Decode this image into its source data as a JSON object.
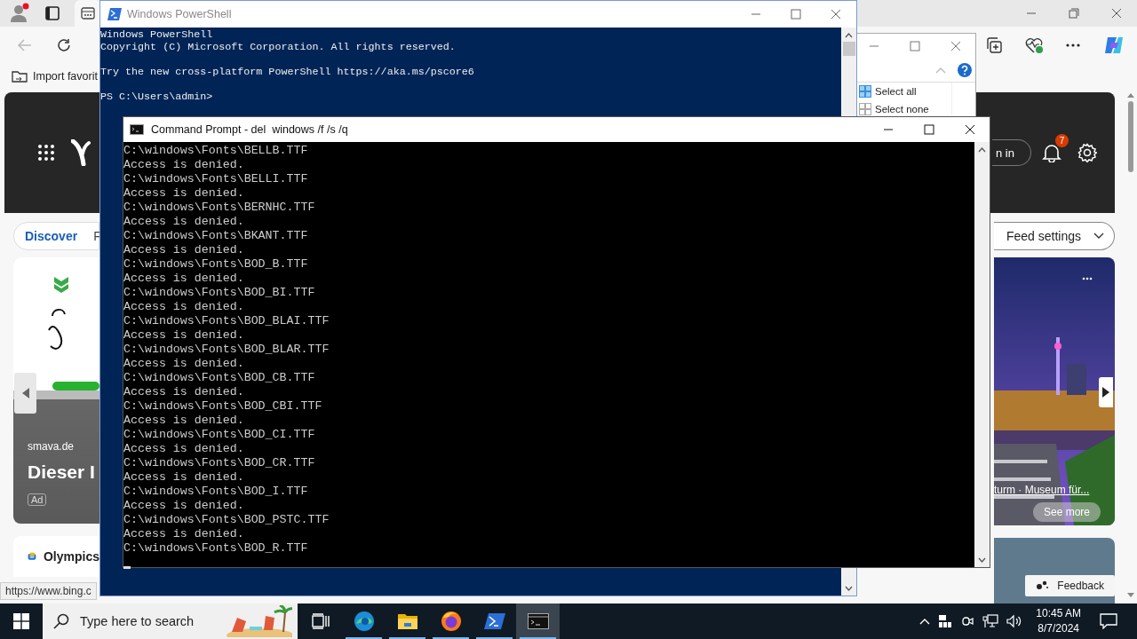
{
  "browser": {
    "favorites_bar": {
      "item": "Import favorit"
    },
    "header": {
      "sign_in": "n in",
      "notifications": "7"
    },
    "feed_tabs": [
      {
        "label": "Discover",
        "selected": true
      },
      {
        "label": "F",
        "selected": false
      }
    ],
    "feed_settings": "Feed settings",
    "ad_card": {
      "source": "smava.de",
      "title": "Dieser I",
      "badge": "Ad"
    },
    "news_card": {
      "caption": "turm · Museum für...",
      "button": "See more"
    },
    "olympics": "Olympics",
    "feedback": "Feedback",
    "status_url": "https://www.bing.c"
  },
  "explorer": {
    "commands": [
      "Select all",
      "Select none"
    ]
  },
  "powershell": {
    "title": "Windows PowerShell",
    "blocks": [
      [
        "Windows PowerShell",
        "Copyright (C) Microsoft Corporation. All rights reserved."
      ],
      [
        "Try the new cross-platform PowerShell https://aka.ms/pscore6"
      ],
      [
        "PS C:\\Users\\admin>"
      ]
    ]
  },
  "cmd": {
    "title": "Command Prompt - del  windows /f /s /q",
    "lines": [
      "C:\\windows\\Fonts\\BELLB.TTF",
      "Access is denied.",
      "C:\\windows\\Fonts\\BELLI.TTF",
      "Access is denied.",
      "C:\\windows\\Fonts\\BERNHC.TTF",
      "Access is denied.",
      "C:\\windows\\Fonts\\BKANT.TTF",
      "Access is denied.",
      "C:\\windows\\Fonts\\BOD_B.TTF",
      "Access is denied.",
      "C:\\windows\\Fonts\\BOD_BI.TTF",
      "Access is denied.",
      "C:\\windows\\Fonts\\BOD_BLAI.TTF",
      "Access is denied.",
      "C:\\windows\\Fonts\\BOD_BLAR.TTF",
      "Access is denied.",
      "C:\\windows\\Fonts\\BOD_CB.TTF",
      "Access is denied.",
      "C:\\windows\\Fonts\\BOD_CBI.TTF",
      "Access is denied.",
      "C:\\windows\\Fonts\\BOD_CI.TTF",
      "Access is denied.",
      "C:\\windows\\Fonts\\BOD_CR.TTF",
      "Access is denied.",
      "C:\\windows\\Fonts\\BOD_I.TTF",
      "Access is denied.",
      "C:\\windows\\Fonts\\BOD_PSTC.TTF",
      "Access is denied.",
      "C:\\windows\\Fonts\\BOD_R.TTF"
    ]
  },
  "taskbar": {
    "search_placeholder": "Type here to search",
    "apps": [
      {
        "kind": "task-view",
        "running": false,
        "selected": false
      },
      {
        "kind": "edge",
        "running": true,
        "selected": false
      },
      {
        "kind": "explorer",
        "running": true,
        "selected": false
      },
      {
        "kind": "firefox",
        "running": true,
        "selected": false
      },
      {
        "kind": "powershell",
        "running": true,
        "selected": false
      },
      {
        "kind": "cmd",
        "running": true,
        "selected": true
      }
    ],
    "time": "10:45 AM",
    "date": "8/7/2024"
  }
}
